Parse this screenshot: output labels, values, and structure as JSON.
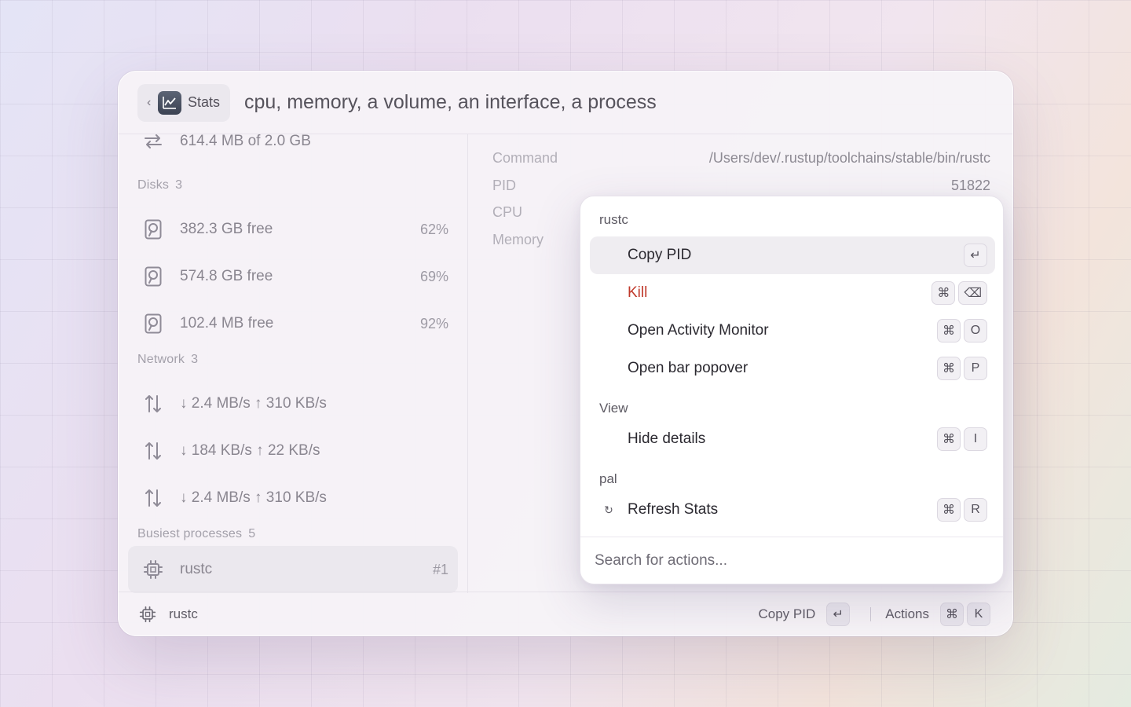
{
  "header": {
    "back_label": "‹",
    "app_name": "Stats",
    "query": "cpu, memory, a volume, an interface, a process"
  },
  "left": {
    "memory_row": {
      "icon": "swap-arrows-icon",
      "label": "614.4 MB of 2.0 GB"
    },
    "disks": {
      "title": "Disks",
      "count": "3",
      "items": [
        {
          "icon": "disk-icon",
          "label": "382.3 GB free",
          "value": "62%"
        },
        {
          "icon": "disk-icon",
          "label": "574.8 GB free",
          "value": "69%"
        },
        {
          "icon": "disk-icon",
          "label": "102.4 MB free",
          "value": "92%"
        }
      ]
    },
    "network": {
      "title": "Network",
      "count": "3",
      "items": [
        {
          "icon": "up-down-arrows-icon",
          "label": "↓ 2.4 MB/s ↑ 310 KB/s"
        },
        {
          "icon": "up-down-arrows-icon",
          "label": "↓ 184 KB/s ↑ 22 KB/s"
        },
        {
          "icon": "up-down-arrows-icon",
          "label": "↓ 2.4 MB/s ↑ 310 KB/s"
        }
      ]
    },
    "processes": {
      "title": "Busiest processes",
      "count": "5",
      "items": [
        {
          "icon": "cpu-chip-icon",
          "label": "rustc",
          "value": "#1"
        }
      ]
    }
  },
  "detail": {
    "rows": [
      {
        "key": "Command",
        "value": "/Users/dev/.rustup/toolchains/stable/bin/rustc"
      },
      {
        "key": "PID",
        "value": "51822"
      },
      {
        "key": "CPU",
        "value": ""
      },
      {
        "key": "Memory",
        "value": ""
      }
    ]
  },
  "footer": {
    "title": "rustc",
    "primary_action": "Copy PID",
    "primary_key": "↵",
    "actions_label": "Actions",
    "actions_keys": [
      "⌘",
      "K"
    ]
  },
  "popover": {
    "sections": [
      {
        "title": "rustc",
        "items": [
          {
            "label": "Copy PID",
            "keys": [
              "↵"
            ],
            "active": true
          },
          {
            "label": "Kill",
            "keys": [
              "⌘",
              "⌫"
            ],
            "danger": true
          },
          {
            "label": "Open Activity Monitor",
            "keys": [
              "⌘",
              "O"
            ]
          },
          {
            "label": "Open bar popover",
            "keys": [
              "⌘",
              "P"
            ]
          }
        ]
      },
      {
        "title": "View",
        "items": [
          {
            "label": "Hide details",
            "keys": [
              "⌘",
              "I"
            ]
          }
        ]
      },
      {
        "title": "pal",
        "items": [
          {
            "label": "Refresh Stats",
            "icon_glyph": "↻",
            "keys": [
              "⌘",
              "R"
            ]
          }
        ]
      }
    ],
    "search_placeholder": "Search for actions..."
  },
  "colors": {
    "danger": "#c0392b",
    "app_icon": "#3b4252"
  }
}
